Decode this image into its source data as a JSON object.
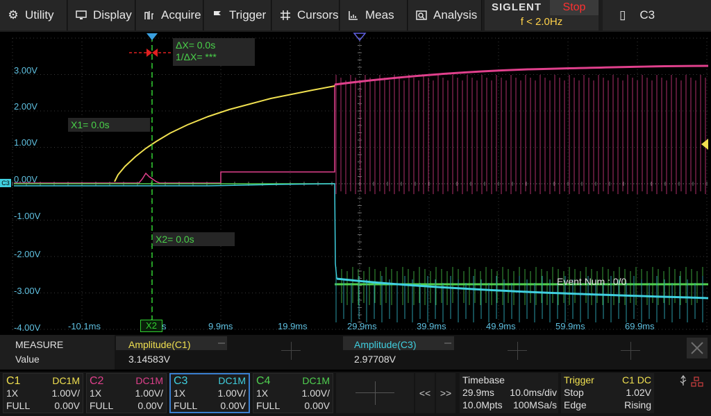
{
  "menu": {
    "utility": "Utility",
    "display": "Display",
    "acquire": "Acquire",
    "trigger": "Trigger",
    "cursors": "Cursors",
    "meas": "Meas",
    "analysis": "Analysis"
  },
  "brand": "SIGLENT",
  "run_state": "Stop",
  "frequency": "f < 2.0Hz",
  "active_channel": "C3",
  "y_labels": [
    "3.00V",
    "2.00V",
    "1.00V",
    "0.00V",
    "-1.00V",
    "-2.00V",
    "-3.00V",
    "-4.00V"
  ],
  "x_labels": [
    "-10.1ms",
    "s",
    "9.9ms",
    "19.9ms",
    "29.9ms",
    "39.9ms",
    "49.9ms",
    "59.9ms",
    "69.9ms"
  ],
  "cursors": {
    "delta_x": "ΔX= 0.0s",
    "inv_delta_x": "1/ΔX= ***",
    "x1": "X1= 0.0s",
    "x2": "X2= 0.0s",
    "x2_tag": "X2"
  },
  "channel_marker": "C3",
  "event_num": "Event Num : 0/0",
  "measure": {
    "title": "MEASURE",
    "value_label": "Value",
    "m1_name": "Amplitude(C1)",
    "m1_value": "3.14583V",
    "m2_name": "Amplitude(C3)",
    "m2_value": "2.97708V"
  },
  "channels": [
    {
      "name": "C1",
      "coupling": "DC1M",
      "probe": "1X",
      "scale": "1.00V/",
      "bw": "FULL",
      "offset": "0.00V",
      "color": "#f0e050"
    },
    {
      "name": "C2",
      "coupling": "DC1M",
      "probe": "1X",
      "scale": "1.00V/",
      "bw": "FULL",
      "offset": "0.00V",
      "color": "#e0408c"
    },
    {
      "name": "C3",
      "coupling": "DC1M",
      "probe": "1X",
      "scale": "1.00V/",
      "bw": "FULL",
      "offset": "0.00V",
      "color": "#40d0e0"
    },
    {
      "name": "C4",
      "coupling": "DC1M",
      "probe": "1X",
      "scale": "1.00V/",
      "bw": "FULL",
      "offset": "0.00V",
      "color": "#50d050"
    }
  ],
  "nav": {
    "prev": "<<",
    "next": ">>"
  },
  "timebase": {
    "title": "Timebase",
    "delay": "29.9ms",
    "scale": "10.0ms/div",
    "memory": "10.0Mpts",
    "sample_rate": "100MSa/s"
  },
  "trigger": {
    "title": "Trigger",
    "source": "C1 DC",
    "mode": "Stop",
    "level": "1.02V",
    "type": "Edge",
    "slope": "Rising"
  },
  "colors": {
    "ch1": "#f0e050",
    "ch2": "#e0408c",
    "ch3": "#40d0e0",
    "ch4": "#50d050",
    "cursor": "#30d030",
    "accent": "#3a7fd0"
  }
}
